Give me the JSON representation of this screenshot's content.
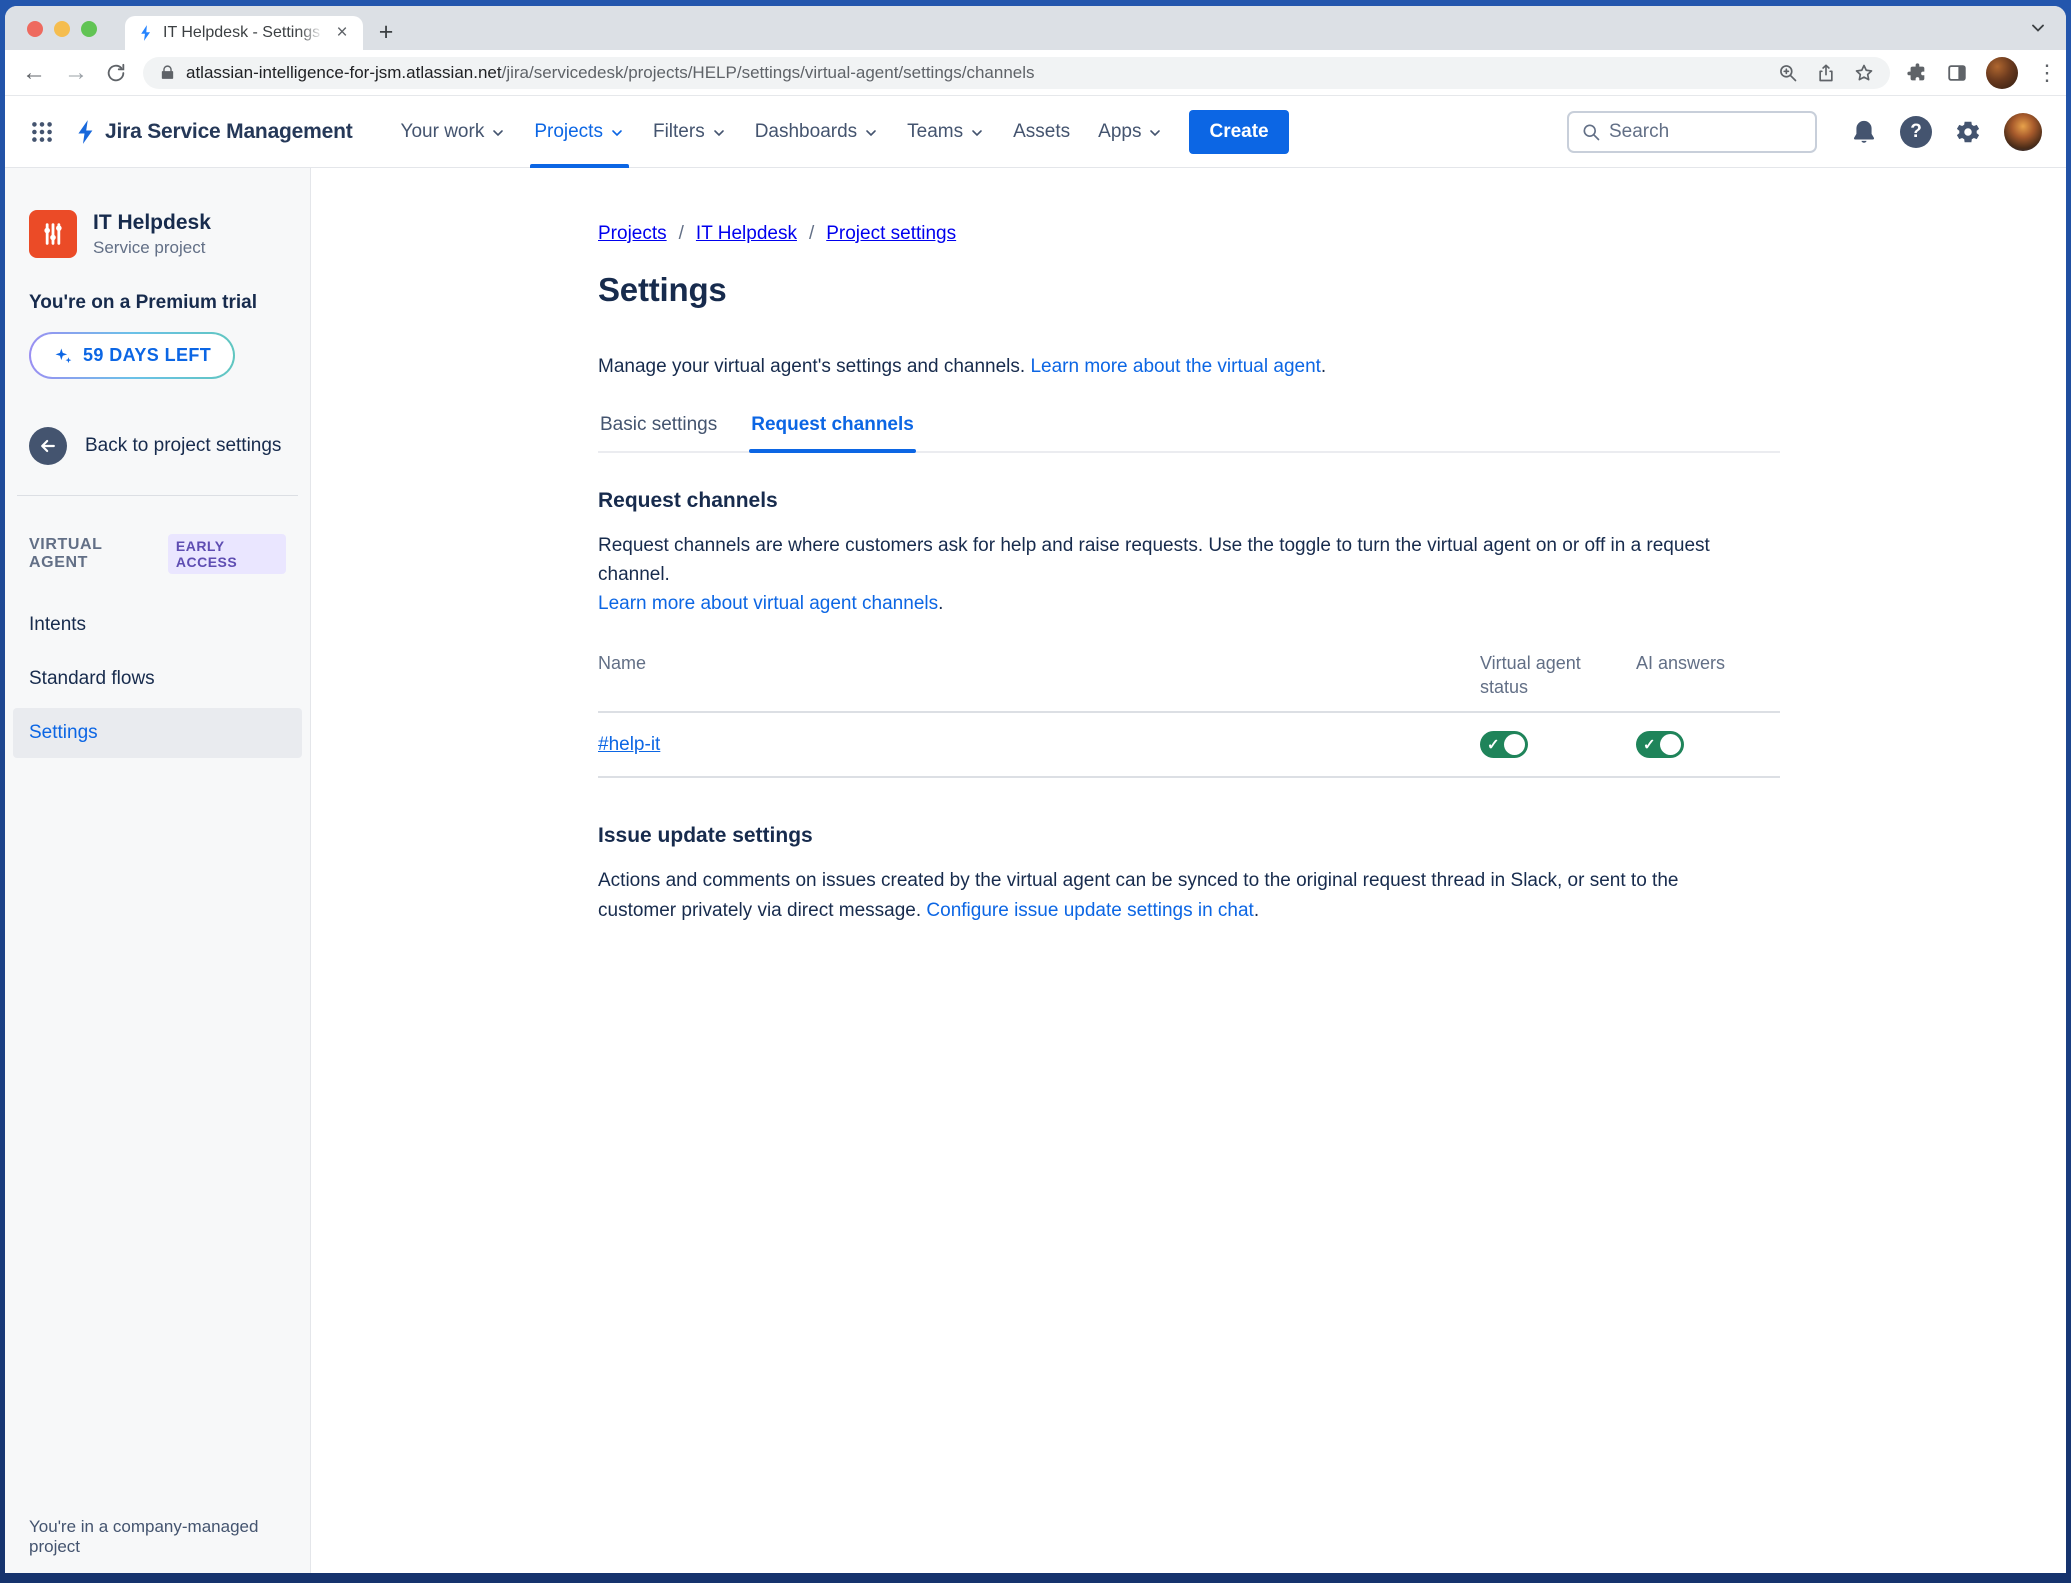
{
  "browser": {
    "tab_title": "IT Helpdesk - Settings - Servic",
    "url_domain": "atlassian-intelligence-for-jsm.atlassian.net",
    "url_path": "/jira/servicedesk/projects/HELP/settings/virtual-agent/settings/channels"
  },
  "nav": {
    "product": "Jira Service Management",
    "items": [
      {
        "label": "Your work",
        "has_chevron": true,
        "active": false
      },
      {
        "label": "Projects",
        "has_chevron": true,
        "active": true
      },
      {
        "label": "Filters",
        "has_chevron": true,
        "active": false
      },
      {
        "label": "Dashboards",
        "has_chevron": true,
        "active": false
      },
      {
        "label": "Teams",
        "has_chevron": true,
        "active": false
      },
      {
        "label": "Assets",
        "has_chevron": false,
        "active": false
      },
      {
        "label": "Apps",
        "has_chevron": true,
        "active": false
      }
    ],
    "create_label": "Create",
    "search_placeholder": "Search"
  },
  "sidebar": {
    "project_name": "IT Helpdesk",
    "project_type": "Service project",
    "trial_text": "You're on a Premium trial",
    "trial_badge": "59 DAYS LEFT",
    "back_label": "Back to project settings",
    "section_label": "VIRTUAL AGENT",
    "section_badge": "EARLY ACCESS",
    "items": [
      {
        "label": "Intents",
        "selected": false
      },
      {
        "label": "Standard flows",
        "selected": false
      },
      {
        "label": "Settings",
        "selected": true
      }
    ],
    "footer": "You're in a company-managed project"
  },
  "main": {
    "breadcrumb": {
      "0": "Projects",
      "1": "IT Helpdesk",
      "2": "Project settings",
      "separator": "/"
    },
    "title": "Settings",
    "intro_text": "Manage your virtual agent's settings and channels.",
    "intro_link": "Learn more about the virtual agent",
    "intro_suffix": ".",
    "tabs": {
      "0": "Basic settings",
      "1": "Request channels"
    },
    "active_tab": "Request channels",
    "request_channels": {
      "heading": "Request channels",
      "description": "Request channels are where customers ask for help and raise requests. Use the toggle to turn the virtual agent on or off in a request channel.",
      "link": "Learn more about virtual agent channels",
      "link_suffix": ".",
      "table": {
        "columns": {
          "0": "Name",
          "1": "Virtual agent status",
          "2": "AI answers"
        },
        "rows": [
          {
            "name": "#help-it",
            "virtual_agent_status": true,
            "ai_answers": true
          }
        ]
      }
    },
    "issue_update": {
      "heading": "Issue update settings",
      "description": "Actions and comments on issues created by the virtual agent can be synced to the original request thread in Slack, or sent to the customer privately via direct message.",
      "link": "Configure issue update settings in chat",
      "link_suffix": "."
    }
  },
  "colors": {
    "accent_blue": "#0C66E4",
    "toggle_on_green": "#1F845A",
    "badge_purple_text": "#5E4DB2",
    "badge_purple_bg": "#EAE6FF",
    "project_icon_orange": "#EB4B27",
    "navy_text": "#172B4D"
  }
}
